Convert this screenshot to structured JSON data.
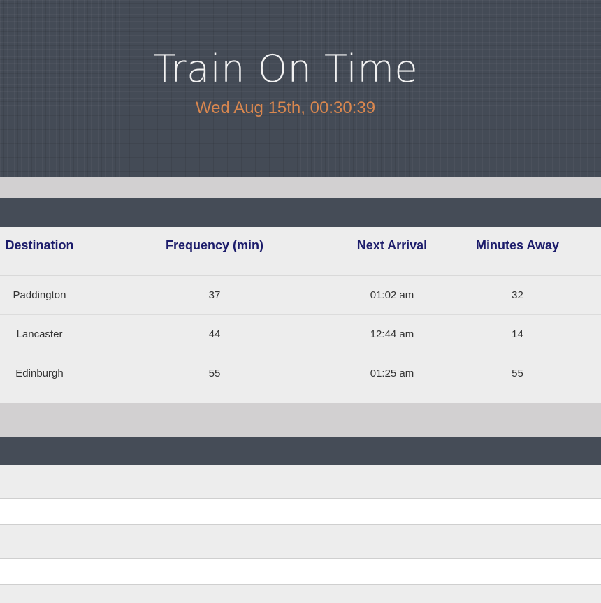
{
  "header": {
    "title": "Train On Time",
    "clock": "Wed Aug 15th, 00:30:39"
  },
  "schedule": {
    "columns": [
      "Destination",
      "Frequency (min)",
      "Next Arrival",
      "Minutes Away"
    ],
    "rows": [
      {
        "destination": "Paddington",
        "frequency": "37",
        "next_arrival": "01:02 am",
        "minutes_away": "32"
      },
      {
        "destination": "Lancaster",
        "frequency": "44",
        "next_arrival": "12:44 am",
        "minutes_away": "14"
      },
      {
        "destination": "Edinburgh",
        "frequency": "55",
        "next_arrival": "01:25 am",
        "minutes_away": "55"
      }
    ]
  },
  "colors": {
    "header_bg": "#444b56",
    "clock_text": "#d9874f",
    "column_header_text": "#1c1c6b",
    "band": "#d2d0d1",
    "panel_head": "#454c57"
  }
}
